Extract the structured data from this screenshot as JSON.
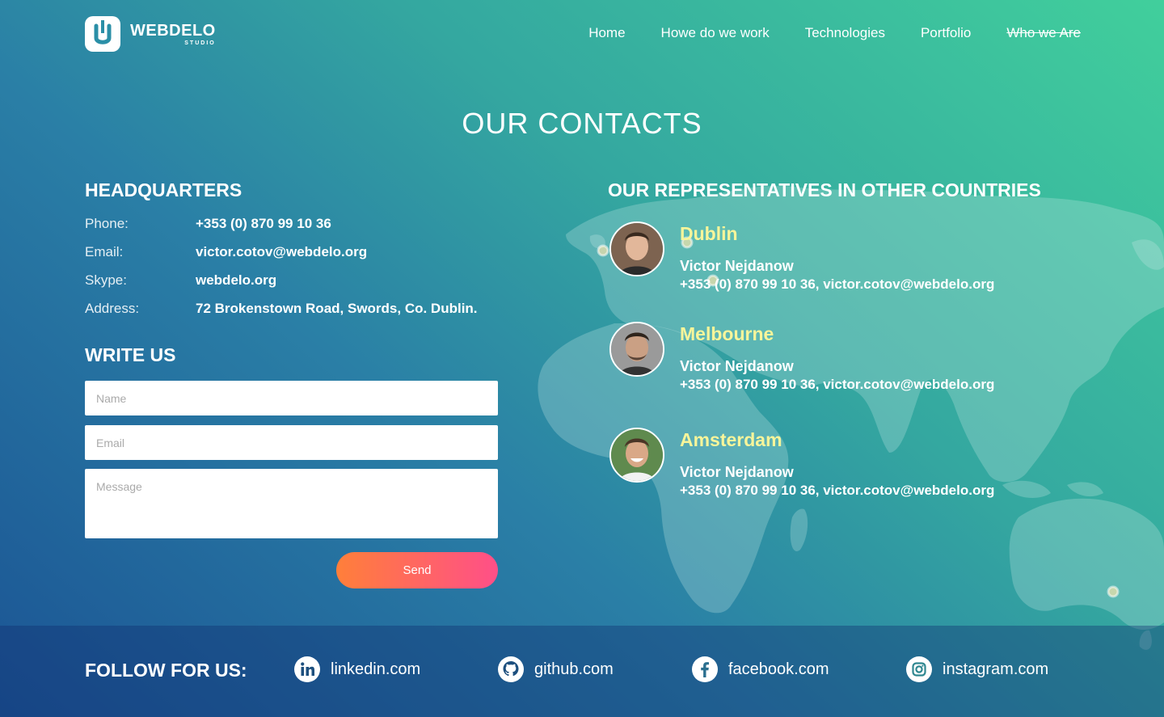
{
  "brand": {
    "name": "WEBDELO",
    "sub": "STUDIO"
  },
  "nav": [
    {
      "label": "Home"
    },
    {
      "label": "Howe do we work"
    },
    {
      "label": "Technologies"
    },
    {
      "label": "Portfolio"
    },
    {
      "label": "Who we Are"
    }
  ],
  "page_title": "OUR CONTACTS",
  "hq": {
    "title": "HEADQUARTERS",
    "rows": [
      {
        "label": "Phone:",
        "value": "+353 (0) 870 99 10 36"
      },
      {
        "label": "Email:",
        "value": "victor.cotov@webdelo.org"
      },
      {
        "label": "Skype:",
        "value": "webdelo.org"
      },
      {
        "label": "Address:",
        "value": "72 Brokenstown Road, Swords, Co. Dublin."
      }
    ]
  },
  "form": {
    "title": "WRITE US",
    "name_placeholder": "Name",
    "email_placeholder": "Email",
    "message_placeholder": "Message",
    "send_label": "Send"
  },
  "reps": {
    "title": "OUR REPRESENTATIVES IN OTHER COUNTRIES",
    "items": [
      {
        "city": "Dublin",
        "name": "Victor Nejdanow",
        "contact": "+353 (0) 870 99 10 36, victor.cotov@webdelo.org"
      },
      {
        "city": "Melbourne",
        "name": "Victor Nejdanow",
        "contact": "+353 (0) 870 99 10 36, victor.cotov@webdelo.org"
      },
      {
        "city": "Amsterdam",
        "name": "Victor Nejdanow",
        "contact": "+353 (0) 870 99 10 36, victor.cotov@webdelo.org"
      }
    ]
  },
  "footer": {
    "follow": "FOLLOW FOR US:",
    "socials": [
      {
        "label": "linkedin.com",
        "icon": "linkedin-icon"
      },
      {
        "label": "github.com",
        "icon": "github-icon"
      },
      {
        "label": "facebook.com",
        "icon": "facebook-icon"
      },
      {
        "label": "instagram.com",
        "icon": "instagram-icon"
      }
    ]
  },
  "colors": {
    "city": "#f8f59a",
    "send_start": "#ff7f3a",
    "send_end": "#ff4f88",
    "bg_start": "#1b5494",
    "bg_end": "#41cf9c"
  }
}
